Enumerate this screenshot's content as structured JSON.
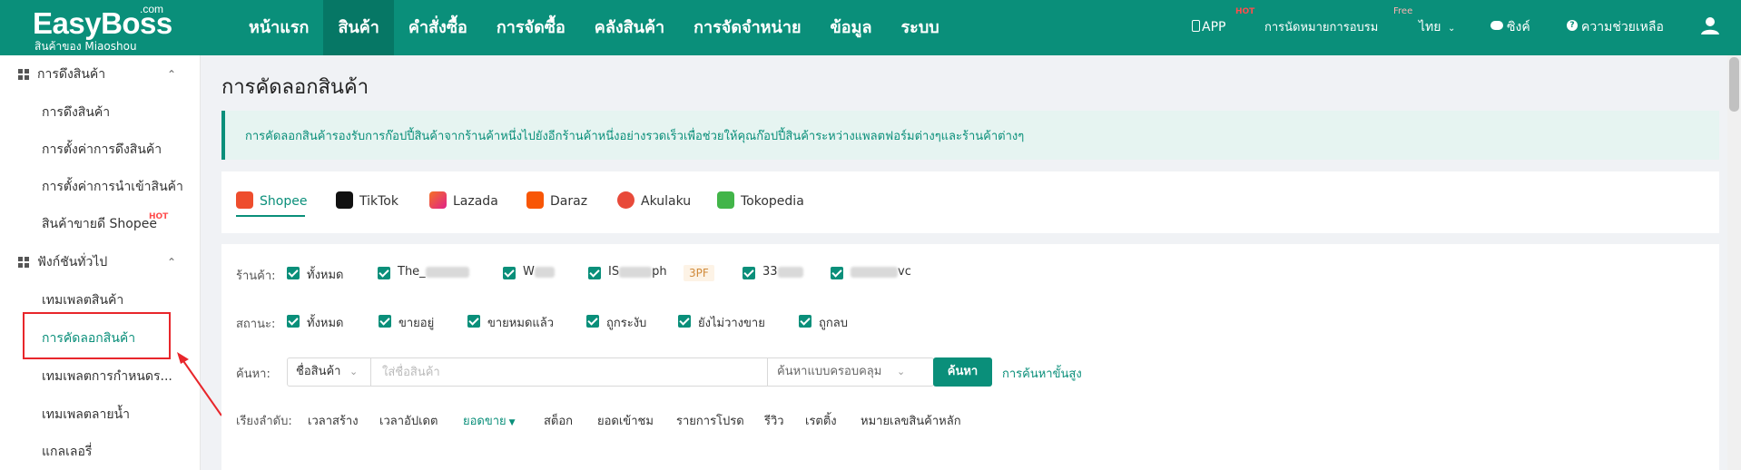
{
  "brand": {
    "name": "EasyBoss",
    "dotcom": ".com",
    "sub": "สินค้าของ Miaoshou"
  },
  "nav": [
    "หน้าแรก",
    "สินค้า",
    "คำสั่งซื้อ",
    "การจัดซื้อ",
    "คลังสินค้า",
    "การจัดจำหน่าย",
    "ข้อมูล",
    "ระบบ"
  ],
  "top_right": {
    "app": "APP",
    "app_badge": "HOT",
    "training": "การนัดหมายการอบรม",
    "training_badge": "Free",
    "language": "ไทย",
    "sync": "ซิงค์",
    "help": "ความช่วยเหลือ"
  },
  "sidebar": {
    "groups": [
      {
        "label": "การดึงสินค้า",
        "items": [
          "การดึงสินค้า",
          "การตั้งค่าการดึงสินค้า",
          "การตั้งค่าการนำเข้าสินค้า",
          "สินค้าขายดี Shopee"
        ]
      },
      {
        "label": "ฟังก์ชันทั่วไป",
        "items": [
          "เทมเพลตสินค้า",
          "การคัดลอกสินค้า",
          "เทมเพลตการกำหนดร...",
          "เทมเพลตลายน้ำ",
          "แกลเลอรี่"
        ]
      }
    ],
    "hot_badge": "HOT"
  },
  "page": {
    "title": "การคัดลอกสินค้า",
    "info": "การคัดลอกสินค้ารองรับการก๊อปปี้สินค้าจากร้านค้าหนึ่งไปยังอีกร้านค้าหนึ่งอย่างรวดเร็วเพื่อช่วยให้คุณก๊อปปี้สินค้าระหว่างแพลตฟอร์มต่างๆและร้านค้าต่างๆ"
  },
  "platform_tabs": [
    {
      "label": "Shopee",
      "color": "#ee4d2d"
    },
    {
      "label": "TikTok",
      "color": "#111111"
    },
    {
      "label": "Lazada",
      "color": "#f57224"
    },
    {
      "label": "Daraz",
      "color": "#f85606"
    },
    {
      "label": "Akulaku",
      "color": "#e84a3a"
    },
    {
      "label": "Tokopedia",
      "color": "#42b549"
    }
  ],
  "filters": {
    "store_label": "ร้านค้า:",
    "stores": [
      "ทั้งหมด",
      "The_",
      "W",
      "IS",
      "33",
      "vc"
    ],
    "store_visible": {
      "the_tail": "",
      "is_suffix": "ph",
      "tag": "3PF"
    },
    "status_label": "สถานะ:",
    "statuses": [
      "ทั้งหมด",
      "ขายอยู่",
      "ขายหมดแล้ว",
      "ถูกระงับ",
      "ยังไม่วางขาย",
      "ถูกลบ"
    ],
    "search_label": "ค้นหา:",
    "search_field": "ชื่อสินค้า",
    "search_placeholder": "ใส่ชื่อสินค้า",
    "search_mode": "ค้นหาแบบครอบคลุม",
    "search_button": "ค้นหา",
    "advanced": "การค้นหาขั้นสูง",
    "sort_label": "เรียงลำดับ:",
    "sort_options": [
      "เวลาสร้าง",
      "เวลาอัปเดต",
      "ยอดขาย",
      "สต็อก",
      "ยอดเข้าชม",
      "รายการโปรด",
      "รีวิว",
      "เรตติ้ง",
      "หมายเลขสินค้าหลัก"
    ]
  },
  "colors": {
    "primary": "#0a8f7a",
    "annotation": "#e8262b"
  }
}
